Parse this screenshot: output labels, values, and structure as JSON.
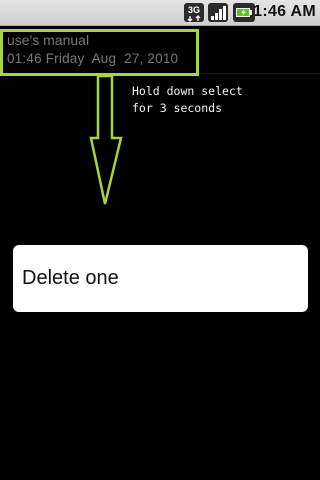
{
  "status_bar": {
    "network_label": "3G",
    "time": "1:46 AM",
    "icons": [
      "network-3g-icon",
      "signal-strength-icon",
      "battery-charging-icon"
    ]
  },
  "note": {
    "title": "use's manual",
    "date": "01:46 Friday  Aug  27, 2010"
  },
  "instruction": {
    "line1": "Hold down select",
    "line2": "for 3 seconds"
  },
  "context_menu": {
    "items": [
      {
        "label": "Delete one"
      }
    ]
  },
  "colors": {
    "background": "#000000",
    "highlight": "#a8d43c",
    "note_text": "#787878",
    "menu_background": "#ffffff"
  }
}
